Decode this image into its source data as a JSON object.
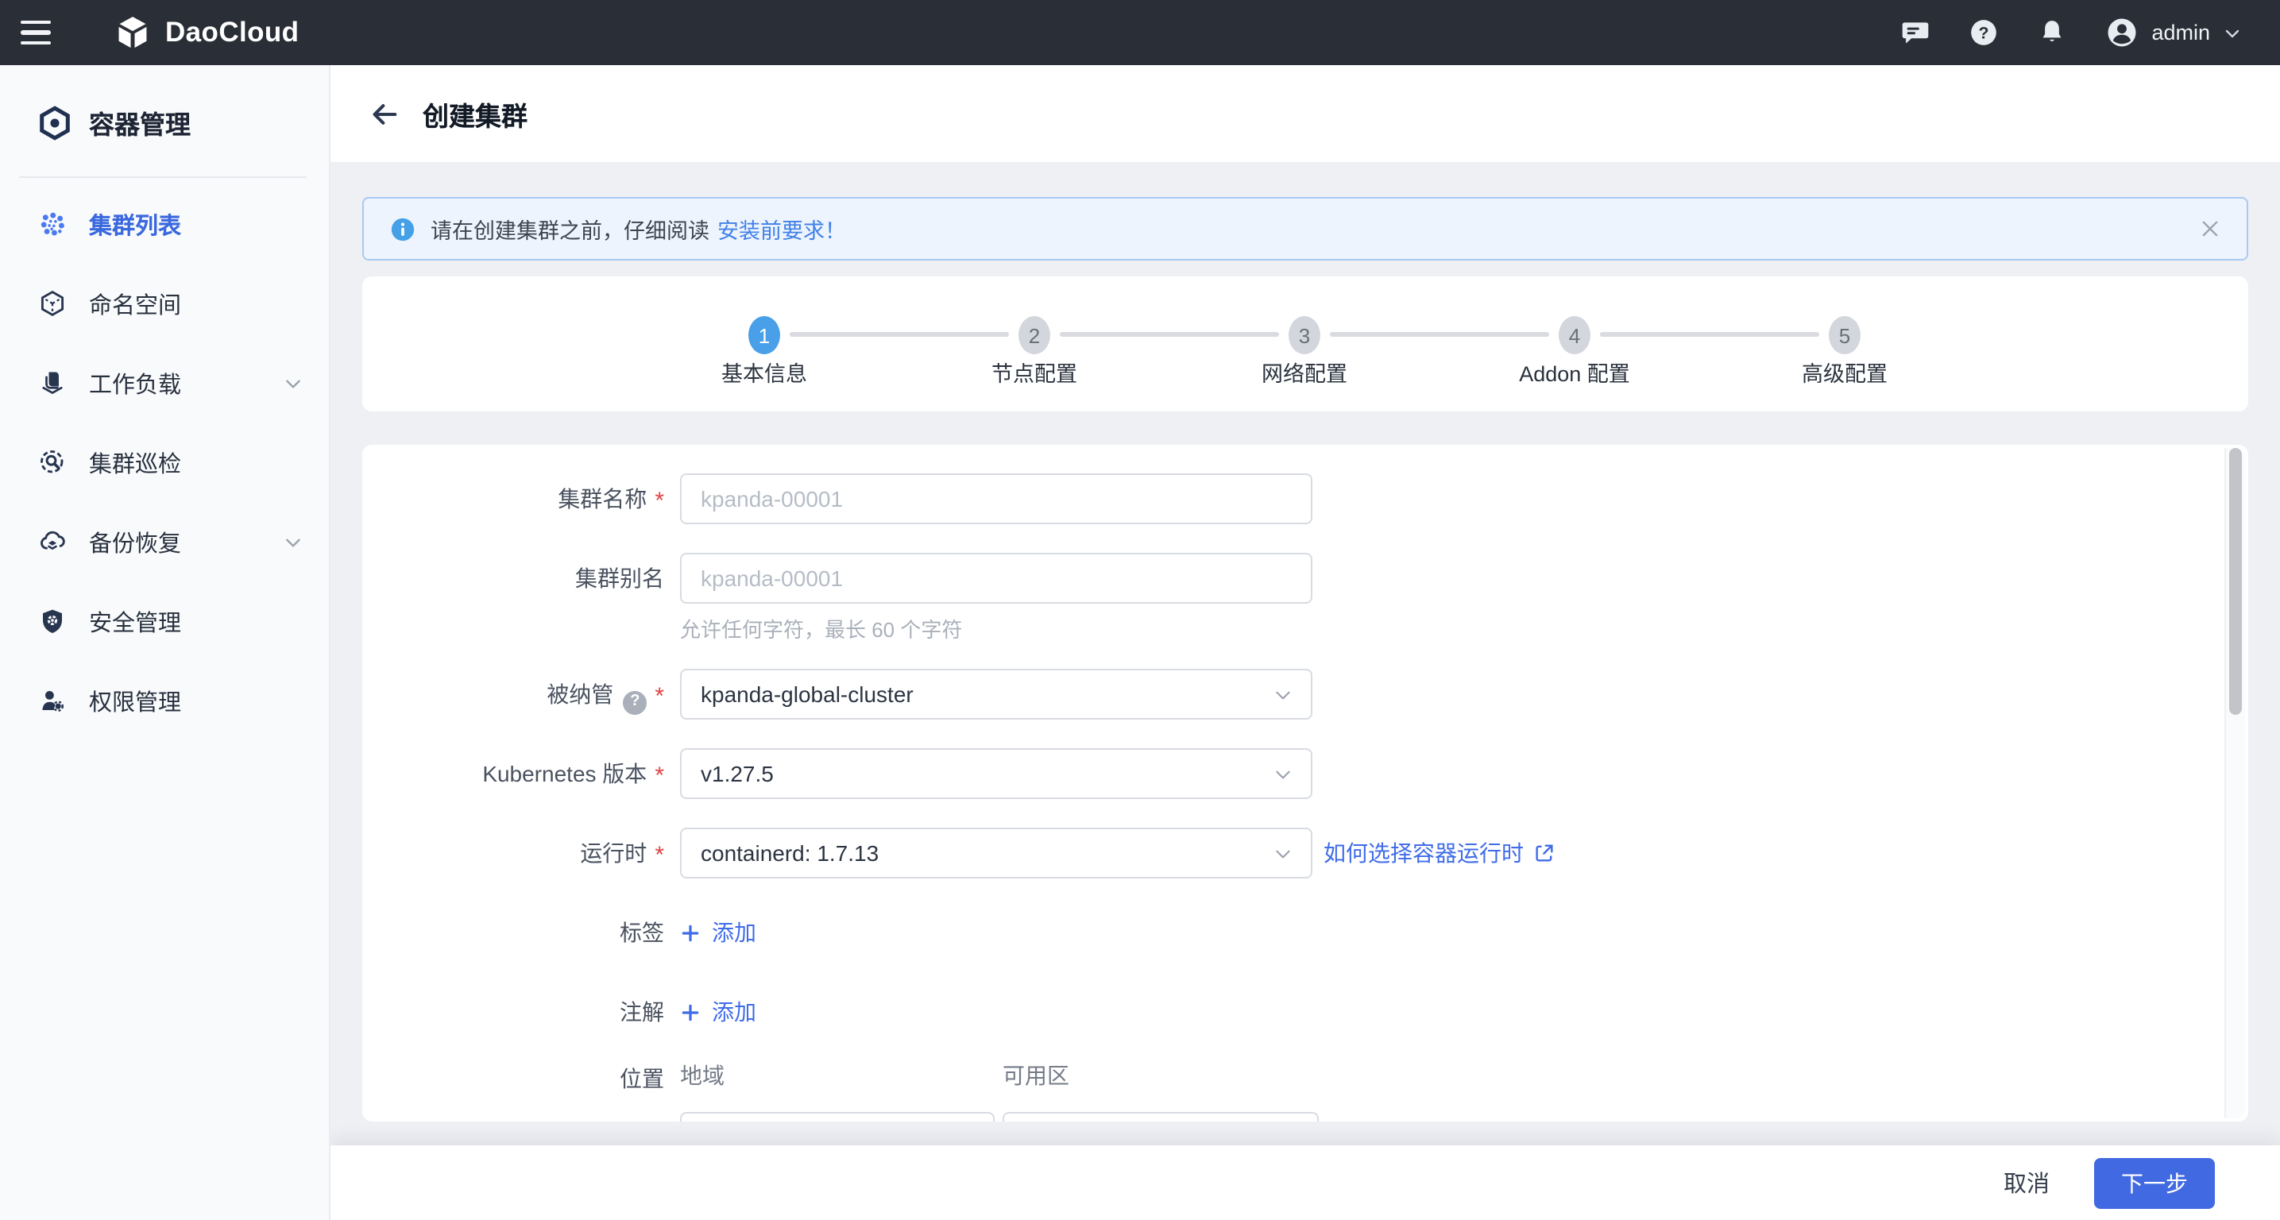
{
  "topbar": {
    "brand": "DaoCloud",
    "username": "admin"
  },
  "sidebar": {
    "module": "容器管理",
    "items": [
      {
        "label": "集群列表",
        "icon": "cluster-list",
        "active": true,
        "expandable": false
      },
      {
        "label": "命名空间",
        "icon": "namespace",
        "active": false,
        "expandable": false
      },
      {
        "label": "工作负载",
        "icon": "workload",
        "active": false,
        "expandable": true
      },
      {
        "label": "集群巡检",
        "icon": "cluster-inspection",
        "active": false,
        "expandable": false
      },
      {
        "label": "备份恢复",
        "icon": "backup-restore",
        "active": false,
        "expandable": true
      },
      {
        "label": "安全管理",
        "icon": "security",
        "active": false,
        "expandable": false
      },
      {
        "label": "权限管理",
        "icon": "permission",
        "active": false,
        "expandable": false
      }
    ]
  },
  "page": {
    "title": "创建集群"
  },
  "banner": {
    "text": "请在创建集群之前，仔细阅读",
    "link_text": "安装前要求！"
  },
  "stepper": {
    "steps": [
      {
        "num": "1",
        "label": "基本信息",
        "state": "active"
      },
      {
        "num": "2",
        "label": "节点配置",
        "state": "upcoming"
      },
      {
        "num": "3",
        "label": "网络配置",
        "state": "upcoming"
      },
      {
        "num": "4",
        "label": "Addon 配置",
        "state": "upcoming"
      },
      {
        "num": "5",
        "label": "高级配置",
        "state": "upcoming"
      }
    ]
  },
  "form": {
    "required_mark": "*",
    "cluster_name": {
      "label": "集群名称",
      "required": true,
      "placeholder": "kpanda-00001"
    },
    "cluster_alias": {
      "label": "集群别名",
      "required": false,
      "placeholder": "kpanda-00001",
      "hint": "允许任何字符，最长 60 个字符"
    },
    "managed_by": {
      "label": "被纳管",
      "required": true,
      "has_help": true,
      "value": "kpanda-global-cluster"
    },
    "kubernetes_version": {
      "label": "Kubernetes 版本",
      "required": true,
      "value": "v1.27.5"
    },
    "runtime": {
      "label": "运行时",
      "required": true,
      "value": "containerd: 1.7.13",
      "help_link": "如何选择容器运行时"
    },
    "labels": {
      "label": "标签",
      "add_text": "添加"
    },
    "annotations": {
      "label": "注解",
      "add_text": "添加"
    },
    "location": {
      "label": "位置",
      "region_label": "地域",
      "zone_label": "可用区"
    }
  },
  "footer": {
    "cancel": "取消",
    "next": "下一步"
  },
  "colors": {
    "topbar_dark": "#2a2e36",
    "accent_blue": "#3a68de",
    "step_active_blue": "#49a0e8",
    "primary_button_blue": "#4169e1",
    "link_blue": "#3f6ce8",
    "required_red": "#e04444",
    "banner_bg": "#edf4fd",
    "banner_border": "#a9c9f0",
    "content_bg": "#eef0f4"
  }
}
